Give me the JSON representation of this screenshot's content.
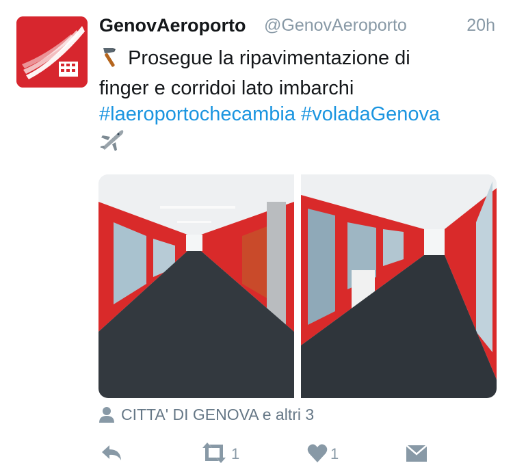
{
  "tweet": {
    "display_name": "GenovAeroporto",
    "screen_name": "@GenovAeroporto",
    "time": "20h",
    "text_line1": "Prosegue la ripavimentazione di",
    "text_line2": "finger e corridoi lato imbarchi",
    "hashtag1": "#laeroportochecambia",
    "hashtag2": "#voladaGenova",
    "leading_emoji": "hammer-icon",
    "trailing_emoji": "airplane-icon"
  },
  "media": {
    "photos": [
      {
        "description_icon": "corridor-photo"
      },
      {
        "description_icon": "corridor-photo"
      }
    ]
  },
  "location": {
    "icon": "person-icon",
    "label": "CITTA' DI GENOVA e altri 3"
  },
  "actions": {
    "reply_icon": "reply-icon",
    "retweet_icon": "retweet-icon",
    "retweet_count": "1",
    "like_icon": "heart-icon",
    "like_count": "1",
    "dm_icon": "envelope-icon"
  },
  "colors": {
    "hashtag": "#1b95e0",
    "muted": "#8899a6",
    "brand_red": "#d7262e"
  }
}
